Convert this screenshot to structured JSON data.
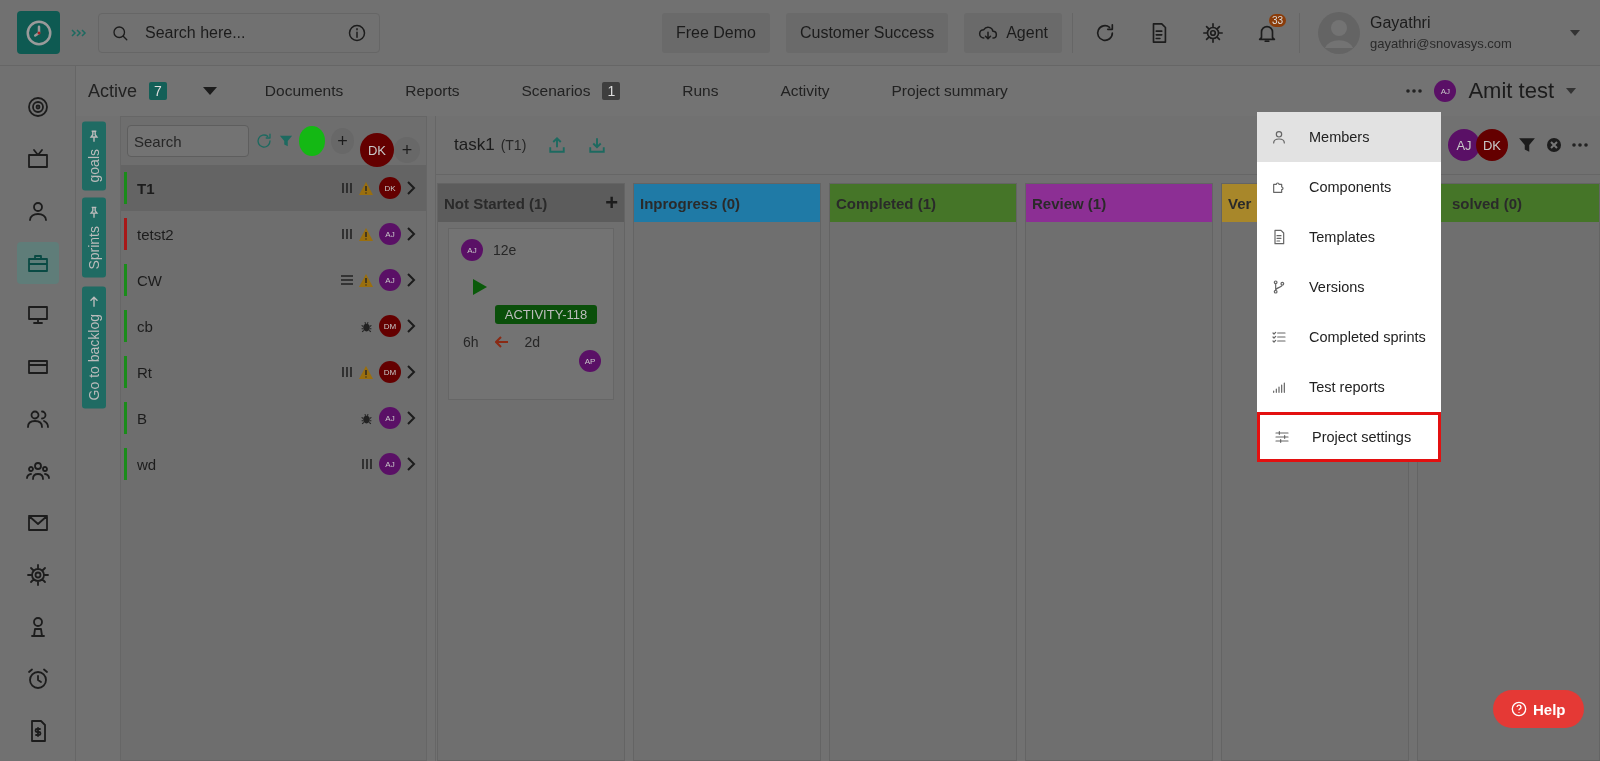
{
  "top_bar": {
    "search_placeholder": "Search here...",
    "buttons": [
      {
        "label": "Free Demo"
      },
      {
        "label": "Customer Success"
      },
      {
        "label": "Agent"
      }
    ],
    "notification_count": "33",
    "user": {
      "name": "Gayathri",
      "email": "gayathri@snovasys.com"
    }
  },
  "rail": [
    {
      "selected": false
    },
    {
      "selected": false
    },
    {
      "selected": false
    },
    {
      "selected": true
    },
    {
      "selected": false
    },
    {
      "selected": false
    },
    {
      "selected": false
    },
    {
      "selected": false
    },
    {
      "selected": false
    },
    {
      "selected": false
    },
    {
      "selected": false
    },
    {
      "selected": false
    },
    {
      "selected": false
    }
  ],
  "project_bar": {
    "status": "Active",
    "status_count": "7",
    "tabs": [
      {
        "label": "Documents"
      },
      {
        "label": "Reports"
      },
      {
        "label": "Scenarios",
        "count": "1"
      },
      {
        "label": "Runs"
      },
      {
        "label": "Activity"
      },
      {
        "label": "Project summary"
      }
    ],
    "project": {
      "avatar": {
        "initials": "AJ",
        "color": "#5a1066"
      },
      "name": "Amit test"
    }
  },
  "side_tabs": [
    {
      "label": "goals"
    },
    {
      "label": "Sprints"
    },
    {
      "label": "Go to backlog"
    }
  ],
  "goals_panel": {
    "search_placeholder": "Search",
    "add_labels": [
      "+",
      "+"
    ],
    "member": {
      "initials": "DK",
      "color": "#640000"
    },
    "goals": [
      {
        "name": "T1",
        "selected": true,
        "color": "#1a8c1a",
        "kind": "bars",
        "warning": true,
        "avatar": {
          "initials": "DK",
          "color": "#640000"
        }
      },
      {
        "name": "tetst2",
        "selected": false,
        "color": "#a81818",
        "kind": "bars",
        "warning": true,
        "avatar": {
          "initials": "AJ",
          "color": "#5a1066"
        }
      },
      {
        "name": "CW",
        "selected": false,
        "color": "#1a8c1a",
        "kind": "lines",
        "warning": true,
        "avatar": {
          "initials": "AJ",
          "color": "#5a1066"
        }
      },
      {
        "name": "cb",
        "selected": false,
        "color": "#1a8c1a",
        "kind": "bug",
        "warning": false,
        "avatar": {
          "initials": "DM",
          "color": "#640000"
        }
      },
      {
        "name": "Rt",
        "selected": false,
        "color": "#1a8c1a",
        "kind": "bars",
        "warning": true,
        "avatar": {
          "initials": "DM",
          "color": "#640000"
        }
      },
      {
        "name": "B",
        "selected": false,
        "color": "#1a8c1a",
        "kind": "bug",
        "warning": false,
        "avatar": {
          "initials": "AJ",
          "color": "#5a1066"
        }
      },
      {
        "name": "wd",
        "selected": false,
        "color": "#1a8c1a",
        "kind": "bars",
        "warning": false,
        "avatar": {
          "initials": "AJ",
          "color": "#5a1066"
        }
      }
    ]
  },
  "board": {
    "title": "task1",
    "code": "(T1)",
    "members": [
      {
        "initials": "AJ",
        "color": "#5a1066"
      },
      {
        "initials": "DK",
        "color": "#640000"
      }
    ],
    "columns": [
      {
        "title": "Not Started (1)",
        "color": "#5c5c5c",
        "add_label": "+",
        "cards": [
          {
            "kind": "estimate",
            "title": "12e",
            "avatar": {
              "initials": "AJ",
              "color": "#5a1066"
            },
            "tag": "ACTIVITY-118",
            "estimate": "6h",
            "remaining": "2d",
            "assignee": {
              "initials": "AP",
              "color": "#5a1066"
            }
          }
        ]
      },
      {
        "title": "Inprogress (0)",
        "color": "#1f7aa6"
      },
      {
        "title": "Completed (1)",
        "color": "#457528"
      },
      {
        "title": "Review (1)",
        "color": "#8c2f94"
      },
      {
        "title": "Ver",
        "color": "#a8872a"
      },
      {
        "title": "solved (0)",
        "color": "#457528"
      }
    ]
  },
  "menu": [
    {
      "label": "Members",
      "selected": true,
      "outlined": false
    },
    {
      "label": "Components",
      "selected": false,
      "outlined": false
    },
    {
      "label": "Templates",
      "selected": false,
      "outlined": false
    },
    {
      "label": "Versions",
      "selected": false,
      "outlined": false
    },
    {
      "label": "Completed sprints",
      "selected": false,
      "outlined": false
    },
    {
      "label": "Test reports",
      "selected": false,
      "outlined": false
    },
    {
      "label": "Project settings",
      "selected": false,
      "outlined": true
    }
  ],
  "help": {
    "label": "Help"
  }
}
